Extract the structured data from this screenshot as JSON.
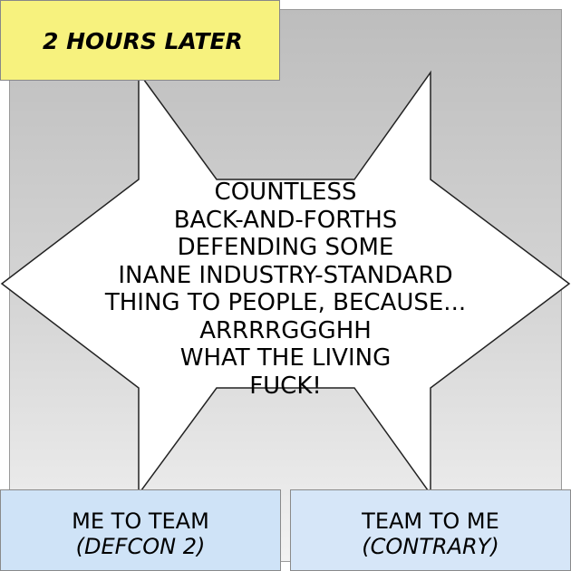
{
  "top_caption": "2 HOURS LATER",
  "burst": {
    "lines": [
      "COUNTLESS",
      "BACK-AND-FORTHS",
      "DEFENDING SOME",
      "INANE INDUSTRY-STANDARD",
      "THING TO PEOPLE, BECAUSE...",
      "ARRRRGGGHH",
      "WHAT THE LIVING",
      "FUCK!"
    ]
  },
  "bottom_left": {
    "line1": "ME TO TEAM",
    "line2": "(DEFCON 2)"
  },
  "bottom_right": {
    "line1": "TEAM TO ME",
    "line2": "(CONTRARY)"
  },
  "colors": {
    "top_caption_bg": "#f7f27e",
    "bottom_caption_bg": "#cfe3f7",
    "panel_gradient_top": "#bdbdbd",
    "panel_gradient_bottom": "#f2f2f2",
    "burst_fill": "#ffffff"
  }
}
